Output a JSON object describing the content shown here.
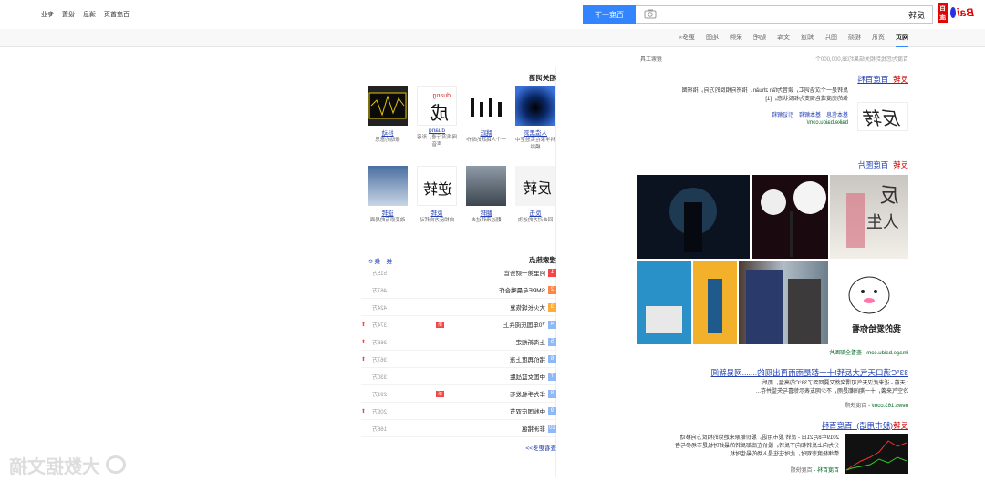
{
  "header": {
    "logo_text": "Bai",
    "logo_cn": "百度",
    "query": "反转",
    "search_button": "百度一下",
    "top_links": [
      "百度首页",
      "消息",
      "设置",
      "专业"
    ]
  },
  "tabs": [
    "网页",
    "资讯",
    "视频",
    "图片",
    "知道",
    "文库",
    "贴吧",
    "采购",
    "地图",
    "更多»"
  ],
  "result_count": "百度为您找到相关结果约38,000,000个",
  "search_tools": "搜索工具",
  "results": {
    "r1": {
      "title_hl": "反转",
      "title": "_百度百科",
      "abstract_1": "反转是一个汉语词汇，读音为fǎn zhuǎn，指将向相反的方向，指将图",
      "abstract_2": "像的亮度或色调变为相反状态。[1]",
      "links": [
        "基本信息",
        "基本解释",
        "引证解释"
      ],
      "url": "baike.baidu.com/",
      "img_text": "反转"
    },
    "r2": {
      "title_hl": "反转",
      "title": "_百度图片",
      "url": "image.baidu.com",
      "more": "查看全部图片"
    },
    "r3": {
      "title": "33°C满口天气大反转!十一都是雨雨再出现的.......网易新闻",
      "abstract_1": "1天前 - 近来武汉天气可谓突然又要回到了33°C的高温，而后",
      "abstract_2": "冷空气来袭，十一期间都是雨，不少网友表示惊喜与失望并存...",
      "url": "news.163.com/",
      "source": "百度快照"
    },
    "r4": {
      "title_hl": "反转",
      "title": "(股市用语)_百度百科",
      "abstract_1": "2019年8月21日 - 反转 股市用语，股价朝原来趋势的相反方向移动",
      "abstract_2": "分为向上反转和向下反转。股价在底部反转的最好时机是市场参与者",
      "abstract_3": "情绪极度悲观时，此时往往是入场的最佳时机...",
      "url": "百度百科",
      "source": "百度快照"
    }
  },
  "related": {
    "title": "相关词语",
    "items": [
      {
        "name": "人造黑洞",
        "desc": "科学家在实验室中模拟"
      },
      {
        "name": "跳跃",
        "desc": "一个人跳跃的动作"
      },
      {
        "name": "duang",
        "desc": "网络流行语，形容声音"
      },
      {
        "name": "抖动",
        "desc": "振动的意思"
      },
      {
        "name": "反击",
        "desc": "回击对方的进攻"
      },
      {
        "name": "翻转",
        "desc": "翻过来转过去"
      },
      {
        "name": "反转",
        "desc": "向相反方向转动"
      },
      {
        "name": "逆转",
        "desc": "改变原有的局面"
      }
    ],
    "item_texts": [
      "duang",
      "反转",
      "逆转"
    ]
  },
  "hot": {
    "title": "搜索热点",
    "refresh": "换一换",
    "more": "查看更多>>",
    "items": [
      {
        "name": "阿里第一财务官",
        "count": "515万",
        "up": false,
        "tag": ""
      },
      {
        "name": "SMPE与晨曦合作",
        "count": "467万",
        "up": false,
        "tag": ""
      },
      {
        "name": "大火长城恢复",
        "count": "424万",
        "up": false,
        "tag": ""
      },
      {
        "name": "70年国庆阅兵上",
        "count": "374万",
        "up": true,
        "tag": "新"
      },
      {
        "name": "上海新规定",
        "count": "368万",
        "up": true,
        "tag": ""
      },
      {
        "name": "猪价再度上涨",
        "count": "367万",
        "up": true,
        "tag": ""
      },
      {
        "name": "中国女篮战胜",
        "count": "330万",
        "up": false,
        "tag": ""
      },
      {
        "name": "华为手机发布",
        "count": "291万",
        "up": false,
        "tag": "新"
      },
      {
        "name": "中秋国庆双节",
        "count": "209万",
        "up": true,
        "tag": ""
      },
      {
        "name": "非洲猪瘟",
        "count": "166万",
        "up": false,
        "tag": ""
      }
    ]
  },
  "watermark": "大数据文摘",
  "colors": {
    "brand_blue": "#3385ff",
    "link": "#2440b3",
    "url_green": "#006621",
    "hot_red": "#f54545"
  }
}
